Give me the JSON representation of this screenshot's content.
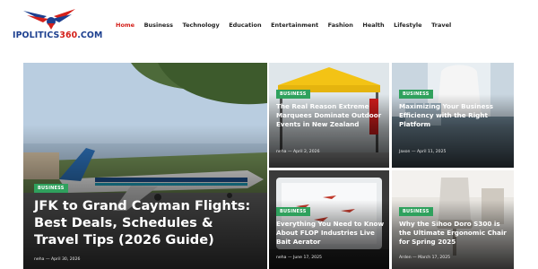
{
  "site": {
    "logo_main": "IPOLITICS",
    "logo_accent": "360",
    "logo_suffix": ".COM"
  },
  "nav": {
    "items": [
      "Home",
      "Business",
      "Technology",
      "Education",
      "Entertainment",
      "Fashion",
      "Health",
      "Lifestyle",
      "Travel"
    ],
    "active": "Home"
  },
  "articles": [
    {
      "category": "BUSINESS",
      "title": "JFK to Grand Cayman Flights: Best Deals, Schedules & Travel Tips (2026 Guide)",
      "author": "neha",
      "date": "April 30, 2026",
      "image": "airplane-photo"
    },
    {
      "category": "BUSINESS",
      "title": "The Real Reason Extreme Marquees Dominate Outdoor Events in New Zealand",
      "author": "neha",
      "date": "April 2, 2026",
      "image": "marquee-tent-photo"
    },
    {
      "category": "BUSINESS",
      "title": "Maximizing Your Business Efficiency with the Right Platform",
      "author": "Jaxon",
      "date": "April 11, 2025",
      "image": "office-photo"
    },
    {
      "category": "BUSINESS",
      "title": "Everything You Need to Know About FLOP Industries Live Bait Aerator",
      "author": "neha",
      "date": "June 17, 2025",
      "image": "bait-tank-photo"
    },
    {
      "category": "BUSINESS",
      "title": "Why the Sihoo Doro S300 is the Ultimate Ergonomic Chair for Spring 2025",
      "author": "Arden",
      "date": "March 17, 2025",
      "image": "chair-photo"
    }
  ],
  "meta_separator": "—"
}
